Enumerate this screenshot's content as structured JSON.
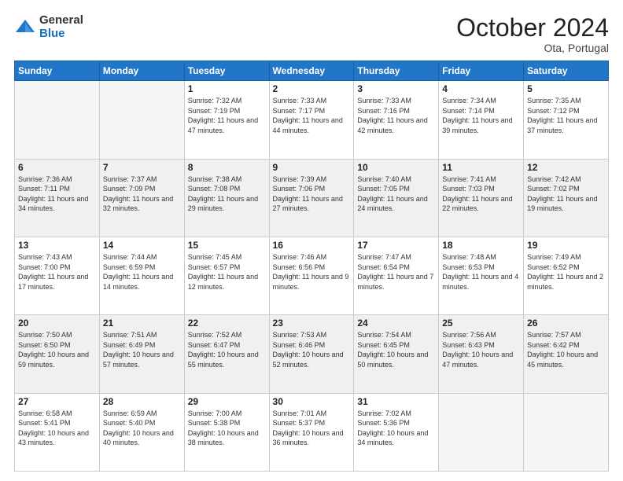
{
  "logo": {
    "general": "General",
    "blue": "Blue"
  },
  "title": "October 2024",
  "location": "Ota, Portugal",
  "days_header": [
    "Sunday",
    "Monday",
    "Tuesday",
    "Wednesday",
    "Thursday",
    "Friday",
    "Saturday"
  ],
  "weeks": [
    [
      {
        "day": "",
        "sunrise": "",
        "sunset": "",
        "daylight": ""
      },
      {
        "day": "",
        "sunrise": "",
        "sunset": "",
        "daylight": ""
      },
      {
        "day": "1",
        "sunrise": "Sunrise: 7:32 AM",
        "sunset": "Sunset: 7:19 PM",
        "daylight": "Daylight: 11 hours and 47 minutes."
      },
      {
        "day": "2",
        "sunrise": "Sunrise: 7:33 AM",
        "sunset": "Sunset: 7:17 PM",
        "daylight": "Daylight: 11 hours and 44 minutes."
      },
      {
        "day": "3",
        "sunrise": "Sunrise: 7:33 AM",
        "sunset": "Sunset: 7:16 PM",
        "daylight": "Daylight: 11 hours and 42 minutes."
      },
      {
        "day": "4",
        "sunrise": "Sunrise: 7:34 AM",
        "sunset": "Sunset: 7:14 PM",
        "daylight": "Daylight: 11 hours and 39 minutes."
      },
      {
        "day": "5",
        "sunrise": "Sunrise: 7:35 AM",
        "sunset": "Sunset: 7:12 PM",
        "daylight": "Daylight: 11 hours and 37 minutes."
      }
    ],
    [
      {
        "day": "6",
        "sunrise": "Sunrise: 7:36 AM",
        "sunset": "Sunset: 7:11 PM",
        "daylight": "Daylight: 11 hours and 34 minutes."
      },
      {
        "day": "7",
        "sunrise": "Sunrise: 7:37 AM",
        "sunset": "Sunset: 7:09 PM",
        "daylight": "Daylight: 11 hours and 32 minutes."
      },
      {
        "day": "8",
        "sunrise": "Sunrise: 7:38 AM",
        "sunset": "Sunset: 7:08 PM",
        "daylight": "Daylight: 11 hours and 29 minutes."
      },
      {
        "day": "9",
        "sunrise": "Sunrise: 7:39 AM",
        "sunset": "Sunset: 7:06 PM",
        "daylight": "Daylight: 11 hours and 27 minutes."
      },
      {
        "day": "10",
        "sunrise": "Sunrise: 7:40 AM",
        "sunset": "Sunset: 7:05 PM",
        "daylight": "Daylight: 11 hours and 24 minutes."
      },
      {
        "day": "11",
        "sunrise": "Sunrise: 7:41 AM",
        "sunset": "Sunset: 7:03 PM",
        "daylight": "Daylight: 11 hours and 22 minutes."
      },
      {
        "day": "12",
        "sunrise": "Sunrise: 7:42 AM",
        "sunset": "Sunset: 7:02 PM",
        "daylight": "Daylight: 11 hours and 19 minutes."
      }
    ],
    [
      {
        "day": "13",
        "sunrise": "Sunrise: 7:43 AM",
        "sunset": "Sunset: 7:00 PM",
        "daylight": "Daylight: 11 hours and 17 minutes."
      },
      {
        "day": "14",
        "sunrise": "Sunrise: 7:44 AM",
        "sunset": "Sunset: 6:59 PM",
        "daylight": "Daylight: 11 hours and 14 minutes."
      },
      {
        "day": "15",
        "sunrise": "Sunrise: 7:45 AM",
        "sunset": "Sunset: 6:57 PM",
        "daylight": "Daylight: 11 hours and 12 minutes."
      },
      {
        "day": "16",
        "sunrise": "Sunrise: 7:46 AM",
        "sunset": "Sunset: 6:56 PM",
        "daylight": "Daylight: 11 hours and 9 minutes."
      },
      {
        "day": "17",
        "sunrise": "Sunrise: 7:47 AM",
        "sunset": "Sunset: 6:54 PM",
        "daylight": "Daylight: 11 hours and 7 minutes."
      },
      {
        "day": "18",
        "sunrise": "Sunrise: 7:48 AM",
        "sunset": "Sunset: 6:53 PM",
        "daylight": "Daylight: 11 hours and 4 minutes."
      },
      {
        "day": "19",
        "sunrise": "Sunrise: 7:49 AM",
        "sunset": "Sunset: 6:52 PM",
        "daylight": "Daylight: 11 hours and 2 minutes."
      }
    ],
    [
      {
        "day": "20",
        "sunrise": "Sunrise: 7:50 AM",
        "sunset": "Sunset: 6:50 PM",
        "daylight": "Daylight: 10 hours and 59 minutes."
      },
      {
        "day": "21",
        "sunrise": "Sunrise: 7:51 AM",
        "sunset": "Sunset: 6:49 PM",
        "daylight": "Daylight: 10 hours and 57 minutes."
      },
      {
        "day": "22",
        "sunrise": "Sunrise: 7:52 AM",
        "sunset": "Sunset: 6:47 PM",
        "daylight": "Daylight: 10 hours and 55 minutes."
      },
      {
        "day": "23",
        "sunrise": "Sunrise: 7:53 AM",
        "sunset": "Sunset: 6:46 PM",
        "daylight": "Daylight: 10 hours and 52 minutes."
      },
      {
        "day": "24",
        "sunrise": "Sunrise: 7:54 AM",
        "sunset": "Sunset: 6:45 PM",
        "daylight": "Daylight: 10 hours and 50 minutes."
      },
      {
        "day": "25",
        "sunrise": "Sunrise: 7:56 AM",
        "sunset": "Sunset: 6:43 PM",
        "daylight": "Daylight: 10 hours and 47 minutes."
      },
      {
        "day": "26",
        "sunrise": "Sunrise: 7:57 AM",
        "sunset": "Sunset: 6:42 PM",
        "daylight": "Daylight: 10 hours and 45 minutes."
      }
    ],
    [
      {
        "day": "27",
        "sunrise": "Sunrise: 6:58 AM",
        "sunset": "Sunset: 5:41 PM",
        "daylight": "Daylight: 10 hours and 43 minutes."
      },
      {
        "day": "28",
        "sunrise": "Sunrise: 6:59 AM",
        "sunset": "Sunset: 5:40 PM",
        "daylight": "Daylight: 10 hours and 40 minutes."
      },
      {
        "day": "29",
        "sunrise": "Sunrise: 7:00 AM",
        "sunset": "Sunset: 5:38 PM",
        "daylight": "Daylight: 10 hours and 38 minutes."
      },
      {
        "day": "30",
        "sunrise": "Sunrise: 7:01 AM",
        "sunset": "Sunset: 5:37 PM",
        "daylight": "Daylight: 10 hours and 36 minutes."
      },
      {
        "day": "31",
        "sunrise": "Sunrise: 7:02 AM",
        "sunset": "Sunset: 5:36 PM",
        "daylight": "Daylight: 10 hours and 34 minutes."
      },
      {
        "day": "",
        "sunrise": "",
        "sunset": "",
        "daylight": ""
      },
      {
        "day": "",
        "sunrise": "",
        "sunset": "",
        "daylight": ""
      }
    ]
  ]
}
